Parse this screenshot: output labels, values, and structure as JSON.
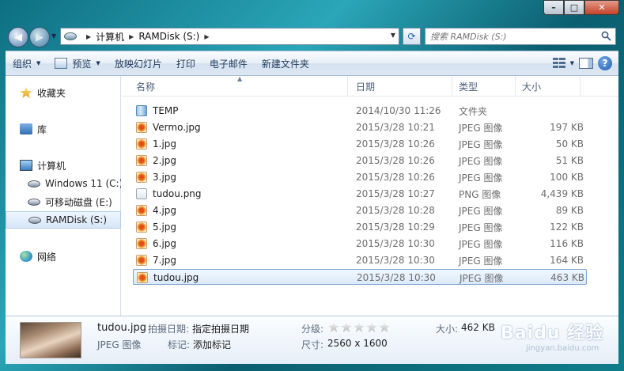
{
  "window": {
    "caption": {
      "minimize": "–",
      "maximize": "□",
      "close": "✕"
    }
  },
  "address": {
    "crumbs": [
      "计算机",
      "RAMDisk (S:)"
    ],
    "search_placeholder": "搜索 RAMDisk (S:)"
  },
  "toolbar": {
    "organize": "组织",
    "preview": "预览",
    "slideshow": "放映幻灯片",
    "print": "打印",
    "email": "电子邮件",
    "new_folder": "新建文件夹",
    "help": "?"
  },
  "nav": {
    "favorites": "收藏夹",
    "libraries": "库",
    "computer": "计算机",
    "drives": [
      "Windows 11 (C:)",
      "可移动磁盘 (E:)",
      "RAMDisk (S:)"
    ],
    "network": "网络"
  },
  "columns": {
    "name": "名称",
    "date": "日期",
    "type": "类型",
    "size": "大小"
  },
  "files": [
    {
      "name": "TEMP",
      "date": "2014/10/30 11:26",
      "type": "文件夹",
      "size": "",
      "icon": "folder"
    },
    {
      "name": "Vermo.jpg",
      "date": "2015/3/28 10:21",
      "type": "JPEG 图像",
      "size": "197 KB",
      "icon": "jpg"
    },
    {
      "name": "1.jpg",
      "date": "2015/3/28 10:26",
      "type": "JPEG 图像",
      "size": "50 KB",
      "icon": "jpg"
    },
    {
      "name": "2.jpg",
      "date": "2015/3/28 10:26",
      "type": "JPEG 图像",
      "size": "51 KB",
      "icon": "jpg"
    },
    {
      "name": "3.jpg",
      "date": "2015/3/28 10:26",
      "type": "JPEG 图像",
      "size": "100 KB",
      "icon": "jpg"
    },
    {
      "name": "tudou.png",
      "date": "2015/3/28 10:27",
      "type": "PNG 图像",
      "size": "4,439 KB",
      "icon": "png"
    },
    {
      "name": "4.jpg",
      "date": "2015/3/28 10:28",
      "type": "JPEG 图像",
      "size": "89 KB",
      "icon": "jpg"
    },
    {
      "name": "5.jpg",
      "date": "2015/3/28 10:29",
      "type": "JPEG 图像",
      "size": "122 KB",
      "icon": "jpg"
    },
    {
      "name": "6.jpg",
      "date": "2015/3/28 10:30",
      "type": "JPEG 图像",
      "size": "116 KB",
      "icon": "jpg"
    },
    {
      "name": "7.jpg",
      "date": "2015/3/28 10:30",
      "type": "JPEG 图像",
      "size": "164 KB",
      "icon": "jpg"
    },
    {
      "name": "tudou.jpg",
      "date": "2015/3/28 10:30",
      "type": "JPEG 图像",
      "size": "463 KB",
      "icon": "jpg",
      "selected": true
    }
  ],
  "details": {
    "filename": "tudou.jpg",
    "shot_date_label": "拍摄日期:",
    "shot_date_value": "指定拍摄日期",
    "filetype": "JPEG 图像",
    "tags_label": "标记:",
    "tags_value": "添加标记",
    "rating_label": "分级:",
    "dims_label": "尺寸:",
    "dims_value": "2560 x 1600",
    "size_label": "大小:",
    "size_value": "462 KB"
  },
  "watermark": {
    "big": "Baidu 经验",
    "small": "jingyan.baidu.com"
  },
  "colors": {
    "highlight": "#d51b1b",
    "selection": "#dbeafb"
  }
}
